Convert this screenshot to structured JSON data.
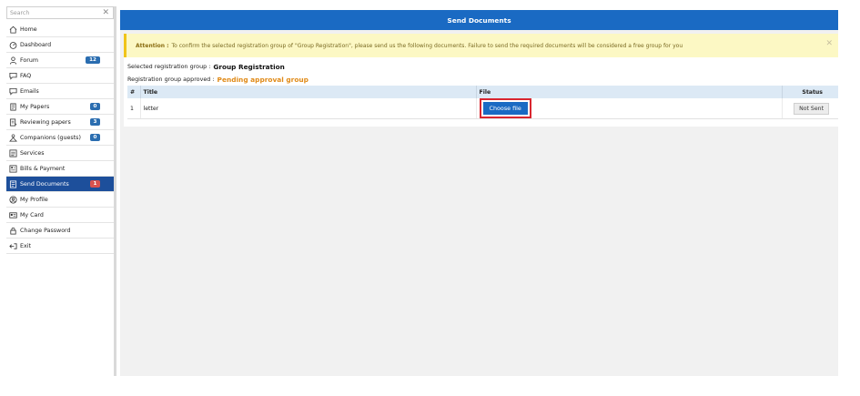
{
  "search": {
    "placeholder": "Search"
  },
  "sidebar": {
    "items": [
      {
        "label": "Home",
        "icon": "home-icon"
      },
      {
        "label": "Dashboard",
        "icon": "dashboard-icon"
      },
      {
        "label": "Forum",
        "icon": "user-icon",
        "badge": "12"
      },
      {
        "label": "FAQ",
        "icon": "chat-icon"
      },
      {
        "label": "Emails",
        "icon": "chat-icon"
      },
      {
        "label": "My Papers",
        "icon": "paper-icon",
        "badge": "0"
      },
      {
        "label": "Reviewing papers",
        "icon": "review-icon",
        "badge": "3"
      },
      {
        "label": "Companions (guests)",
        "icon": "companions-icon",
        "badge": "0"
      },
      {
        "label": "Services",
        "icon": "services-icon"
      },
      {
        "label": "Bills & Payment",
        "icon": "bill-icon"
      },
      {
        "label": "Send Documents",
        "icon": "document-icon",
        "badge": "1",
        "active": true
      },
      {
        "label": "My Profile",
        "icon": "profile-icon"
      },
      {
        "label": "My Card",
        "icon": "card-icon"
      },
      {
        "label": "Change Password",
        "icon": "lock-icon"
      },
      {
        "label": "Exit",
        "icon": "exit-icon"
      }
    ]
  },
  "main": {
    "title": "Send Documents",
    "attention": {
      "label": "Attention :",
      "text": "To confirm the selected registration group of \"Group Registration\", please send us the following documents. Failure to send the required documents will be considered a free group for you"
    },
    "selected_group_label": "Selected registration group :",
    "selected_group_value": "Group Registration",
    "approved_label": "Registration group approved :",
    "approved_value": "Pending approval group",
    "table": {
      "headers": [
        "#",
        "Title",
        "File",
        "Status"
      ],
      "rows": [
        {
          "num": "1",
          "title": "letter",
          "file_button": "Choose file",
          "status": "Not Sent"
        }
      ]
    }
  },
  "colors": {
    "primary": "#1a6ac3",
    "active_sidebar": "#1d4f9b",
    "pending": "#e08a17",
    "attention_bg": "#fcf8c4",
    "badge_red": "#d9534f",
    "highlight": "#d9262f"
  }
}
